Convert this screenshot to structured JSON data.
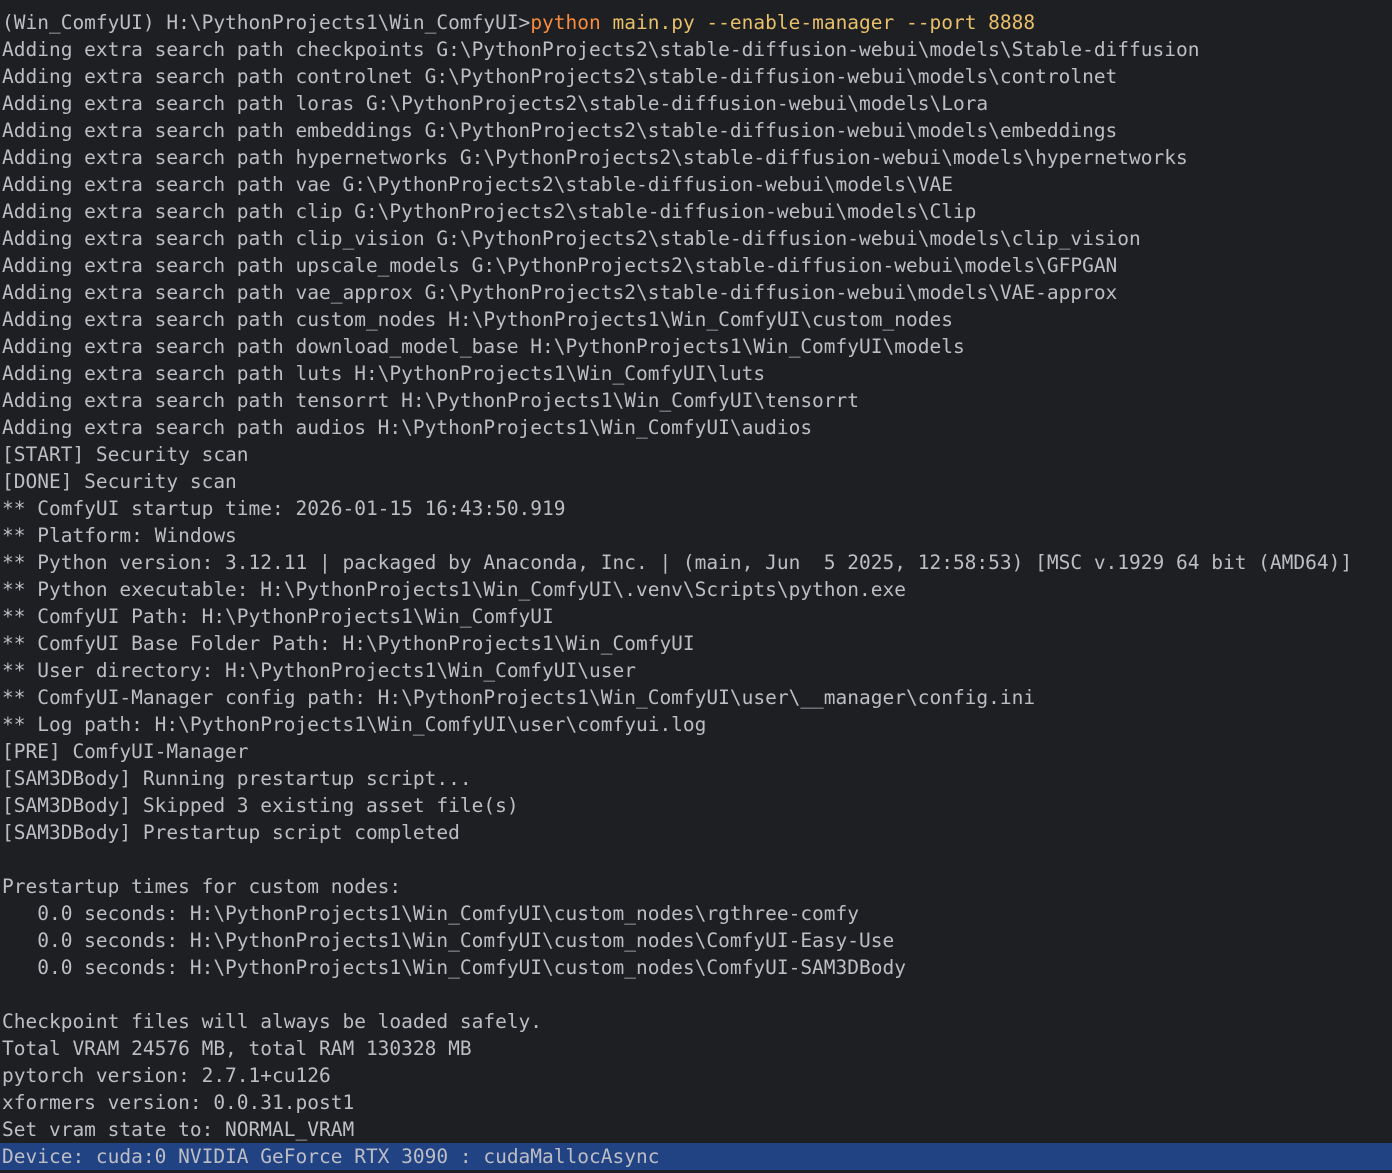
{
  "terminal": {
    "prompt_env": "(Win_ComfyUI) H:\\PythonProjects1\\Win_ComfyUI>",
    "prompt_cmd": "python",
    "prompt_args": " main.py --enable-manager --port 8888",
    "lines": [
      "Adding extra search path checkpoints G:\\PythonProjects2\\stable-diffusion-webui\\models\\Stable-diffusion",
      "Adding extra search path controlnet G:\\PythonProjects2\\stable-diffusion-webui\\models\\controlnet",
      "Adding extra search path loras G:\\PythonProjects2\\stable-diffusion-webui\\models\\Lora",
      "Adding extra search path embeddings G:\\PythonProjects2\\stable-diffusion-webui\\models\\embeddings",
      "Adding extra search path hypernetworks G:\\PythonProjects2\\stable-diffusion-webui\\models\\hypernetworks",
      "Adding extra search path vae G:\\PythonProjects2\\stable-diffusion-webui\\models\\VAE",
      "Adding extra search path clip G:\\PythonProjects2\\stable-diffusion-webui\\models\\Clip",
      "Adding extra search path clip_vision G:\\PythonProjects2\\stable-diffusion-webui\\models\\clip_vision",
      "Adding extra search path upscale_models G:\\PythonProjects2\\stable-diffusion-webui\\models\\GFPGAN",
      "Adding extra search path vae_approx G:\\PythonProjects2\\stable-diffusion-webui\\models\\VAE-approx",
      "Adding extra search path custom_nodes H:\\PythonProjects1\\Win_ComfyUI\\custom_nodes",
      "Adding extra search path download_model_base H:\\PythonProjects1\\Win_ComfyUI\\models",
      "Adding extra search path luts H:\\PythonProjects1\\Win_ComfyUI\\luts",
      "Adding extra search path tensorrt H:\\PythonProjects1\\Win_ComfyUI\\tensorrt",
      "Adding extra search path audios H:\\PythonProjects1\\Win_ComfyUI\\audios",
      "[START] Security scan",
      "[DONE] Security scan",
      "** ComfyUI startup time: 2026-01-15 16:43:50.919",
      "** Platform: Windows",
      "** Python version: 3.12.11 | packaged by Anaconda, Inc. | (main, Jun  5 2025, 12:58:53) [MSC v.1929 64 bit (AMD64)]",
      "** Python executable: H:\\PythonProjects1\\Win_ComfyUI\\.venv\\Scripts\\python.exe",
      "** ComfyUI Path: H:\\PythonProjects1\\Win_ComfyUI",
      "** ComfyUI Base Folder Path: H:\\PythonProjects1\\Win_ComfyUI",
      "** User directory: H:\\PythonProjects1\\Win_ComfyUI\\user",
      "** ComfyUI-Manager config path: H:\\PythonProjects1\\Win_ComfyUI\\user\\__manager\\config.ini",
      "** Log path: H:\\PythonProjects1\\Win_ComfyUI\\user\\comfyui.log",
      "[PRE] ComfyUI-Manager",
      "[SAM3DBody] Running prestartup script...",
      "[SAM3DBody] Skipped 3 existing asset file(s)",
      "[SAM3DBody] Prestartup script completed",
      "",
      "Prestartup times for custom nodes:",
      "   0.0 seconds: H:\\PythonProjects1\\Win_ComfyUI\\custom_nodes\\rgthree-comfy",
      "   0.0 seconds: H:\\PythonProjects1\\Win_ComfyUI\\custom_nodes\\ComfyUI-Easy-Use",
      "   0.0 seconds: H:\\PythonProjects1\\Win_ComfyUI\\custom_nodes\\ComfyUI-SAM3DBody",
      "",
      "Checkpoint files will always be loaded safely.",
      "Total VRAM 24576 MB, total RAM 130328 MB",
      "pytorch version: 2.7.1+cu126",
      "xformers version: 0.0.31.post1",
      "Set vram state to: NORMAL_VRAM"
    ],
    "selected_line": "Device: cuda:0 NVIDIA GeForce RTX 3090 : cudaMallocAsync"
  },
  "colors": {
    "background": "#1e1f22",
    "text": "#bcbec4",
    "command": "#fa8b3c",
    "args": "#e8bf6a",
    "selection": "#214283"
  }
}
